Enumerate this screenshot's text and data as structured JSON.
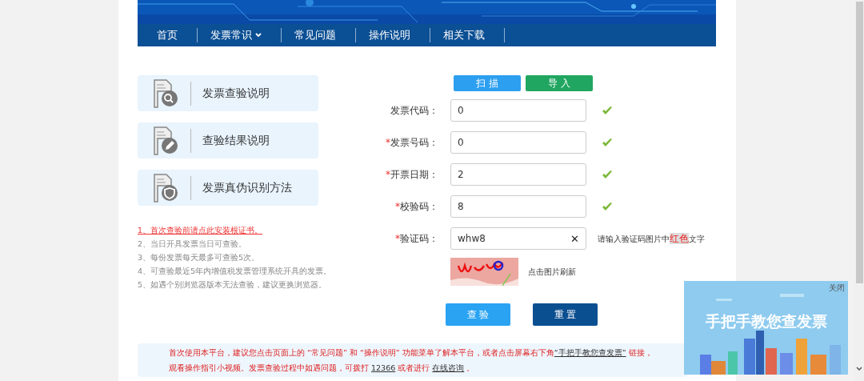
{
  "nav": [
    {
      "label": "首页",
      "has_menu": false
    },
    {
      "label": "发票常识",
      "has_menu": true
    },
    {
      "label": "常见问题",
      "has_menu": false
    },
    {
      "label": "操作说明",
      "has_menu": false
    },
    {
      "label": "相关下载",
      "has_menu": false
    }
  ],
  "cards": [
    {
      "label": "发票查验说明",
      "kind": "search"
    },
    {
      "label": "查验结果说明",
      "kind": "edit"
    },
    {
      "label": "发票真伪识别方法",
      "kind": "shield"
    }
  ],
  "notes": [
    {
      "text": "1、首次查验前请点此安装根证书。",
      "kind": "link"
    },
    {
      "text": "2、当日开具发票当日可查验。",
      "kind": "text"
    },
    {
      "text": "3、每份发票每天最多可查验5次。",
      "kind": "text"
    },
    {
      "text": "4、可查验最近5年内增值税发票管理系统开具的发票。",
      "kind": "text"
    },
    {
      "text": "5、如遇个别浏览器版本无法查验，建议更换浏览器。",
      "kind": "text"
    }
  ],
  "top_buttons": [
    {
      "label": "扫 描",
      "kind": "scan"
    },
    {
      "label": "导 入",
      "kind": "import"
    }
  ],
  "fields": [
    {
      "label": "发票代码：",
      "value": "0",
      "valid": true,
      "kind": "text"
    },
    {
      "marker": "*",
      "label": "发票号码：",
      "value": "0",
      "valid": true,
      "kind": "text"
    },
    {
      "marker": "*",
      "label": "开票日期：",
      "value": "2",
      "valid": true,
      "kind": "text"
    },
    {
      "marker": "*",
      "label": "校验码：",
      "value": "8",
      "valid": true,
      "kind": "text"
    },
    {
      "marker": "*",
      "label": "验证码：",
      "value": "whw8",
      "kind": "captcha",
      "clear": "✕",
      "hint_before": "请输入验证码图片中",
      "hint_highlight": "红色",
      "hint_after": "文字"
    }
  ],
  "captcha": {
    "refresh_text": "点击图片刷新"
  },
  "actions": [
    {
      "label": "查 验",
      "kind": "check"
    },
    {
      "label": "重 置",
      "kind": "reset"
    }
  ],
  "notice": [
    {
      "text": "首次使用本平台，建议您点击页面上的 “常见问题” 和 “操作说明” 功能菜单了解本平台，或者点击屏幕右下角",
      "kind": "text"
    },
    {
      "text": "“手把手教您查发票”",
      "kind": "link"
    },
    {
      "text": " 链接，观看操作指引小视频。发票查验过程中如遇问题，可拨打 ",
      "kind": "text"
    },
    {
      "text": "12366",
      "kind": "link"
    },
    {
      "text": " 或者进行 ",
      "kind": "text"
    },
    {
      "text": "在线咨询",
      "kind": "link"
    },
    {
      "text": " 。",
      "kind": "text"
    }
  ],
  "ad": {
    "close": "关闭",
    "title": "手把手教您查发票"
  }
}
